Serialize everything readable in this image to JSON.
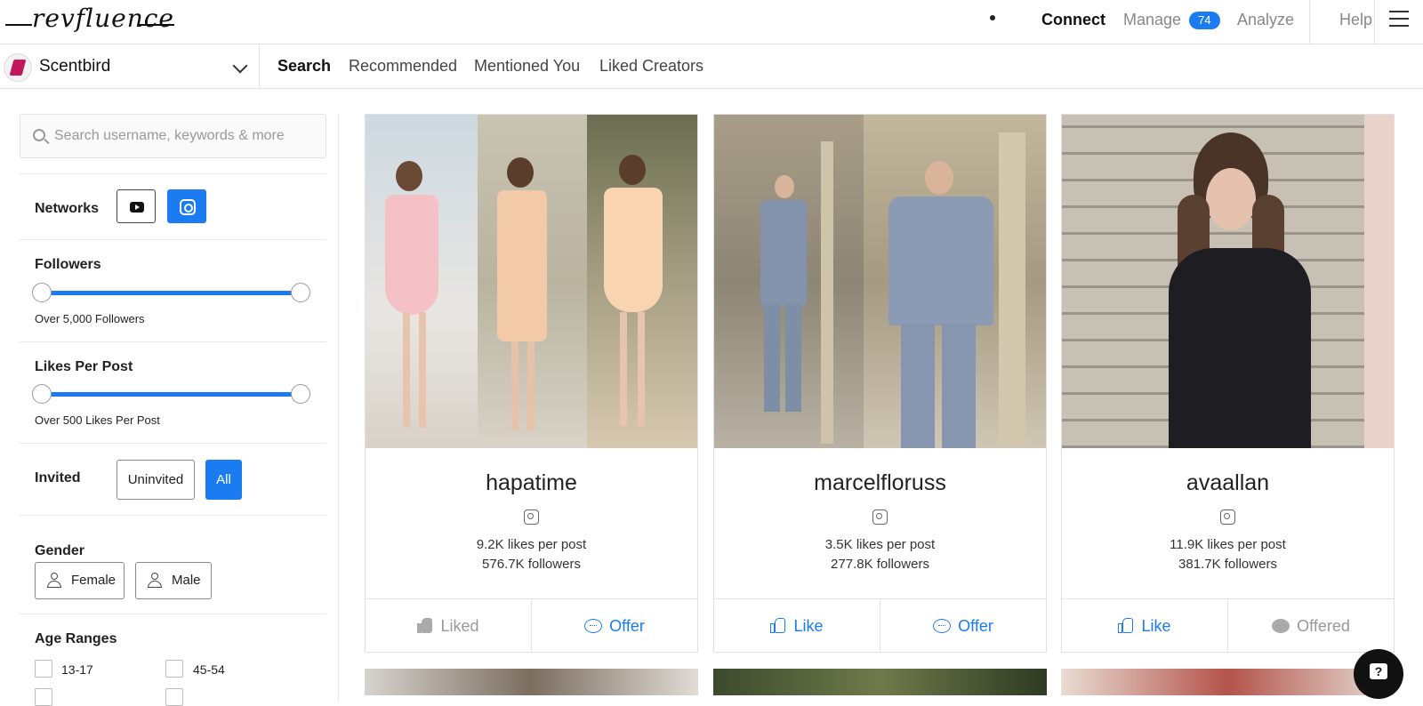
{
  "header": {
    "logo_text": "revfluence",
    "nav": {
      "connect": "Connect",
      "manage": "Manage",
      "manage_count": "74",
      "analyze": "Analyze",
      "help": "Help"
    }
  },
  "subnav": {
    "brand_name": "Scentbird",
    "tabs": [
      "Search",
      "Recommended",
      "Mentioned You",
      "Liked Creators"
    ],
    "active_tab": "Search"
  },
  "filters": {
    "search_placeholder": "Search username, keywords & more",
    "networks_label": "Networks",
    "networks": [
      {
        "name": "youtube",
        "selected": false
      },
      {
        "name": "instagram",
        "selected": true
      }
    ],
    "followers": {
      "label": "Followers",
      "note": "Over 5,000 Followers"
    },
    "likes": {
      "label": "Likes Per Post",
      "note": "Over 500 Likes Per Post"
    },
    "invited": {
      "label": "Invited",
      "options": [
        "Uninvited",
        "All"
      ],
      "selected": "All"
    },
    "gender": {
      "label": "Gender",
      "options": [
        "Female",
        "Male"
      ]
    },
    "age": {
      "label": "Age Ranges",
      "options": [
        "13-17",
        "45-54"
      ]
    }
  },
  "creators": [
    {
      "username": "hapatime",
      "likes": "9.2K likes per post",
      "followers": "576.7K followers",
      "like_label": "Liked",
      "like_state": "done",
      "offer_label": "Offer",
      "offer_state": "active"
    },
    {
      "username": "marcelfloruss",
      "likes": "3.5K likes per post",
      "followers": "277.8K followers",
      "like_label": "Like",
      "like_state": "active",
      "offer_label": "Offer",
      "offer_state": "active"
    },
    {
      "username": "avaallan",
      "likes": "11.9K likes per post",
      "followers": "381.7K followers",
      "like_label": "Like",
      "like_state": "active",
      "offer_label": "Offered",
      "offer_state": "done"
    }
  ],
  "colors": {
    "accent": "#1a7cf0",
    "muted": "#999999"
  }
}
